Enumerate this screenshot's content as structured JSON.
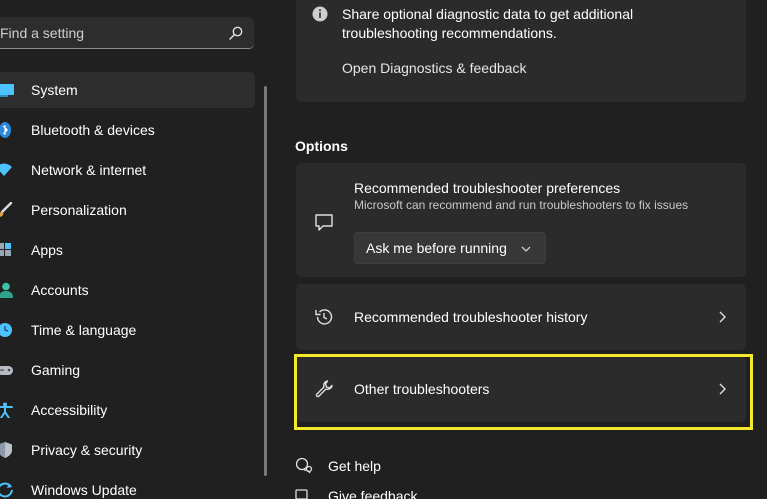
{
  "search": {
    "placeholder": "Find a setting"
  },
  "sidebar": {
    "items": [
      {
        "label": "System",
        "icon": "system-icon",
        "selected": true
      },
      {
        "label": "Bluetooth & devices",
        "icon": "bluetooth-icon"
      },
      {
        "label": "Network & internet",
        "icon": "wifi-icon"
      },
      {
        "label": "Personalization",
        "icon": "brush-icon"
      },
      {
        "label": "Apps",
        "icon": "apps-icon"
      },
      {
        "label": "Accounts",
        "icon": "person-icon"
      },
      {
        "label": "Time & language",
        "icon": "globe-clock-icon"
      },
      {
        "label": "Gaming",
        "icon": "gamepad-icon"
      },
      {
        "label": "Accessibility",
        "icon": "accessibility-icon"
      },
      {
        "label": "Privacy & security",
        "icon": "shield-icon"
      },
      {
        "label": "Windows Update",
        "icon": "update-icon"
      }
    ]
  },
  "info": {
    "text": "Share optional diagnostic data to get additional troubleshooting recommendations.",
    "link": "Open Diagnostics & feedback"
  },
  "options": {
    "title": "Options",
    "preferences": {
      "title": "Recommended troubleshooter preferences",
      "description": "Microsoft can recommend and run troubleshooters to fix issues",
      "dropdown_value": "Ask me before running"
    },
    "history_label": "Recommended troubleshooter history",
    "other_label": "Other troubleshooters"
  },
  "bottom": {
    "help": "Get help",
    "feedback": "Give feedback"
  },
  "colors": {
    "background": "#202020",
    "card": "#2b2b2b",
    "highlight": "#f4ea2c",
    "accent": "#4cc2ff"
  }
}
